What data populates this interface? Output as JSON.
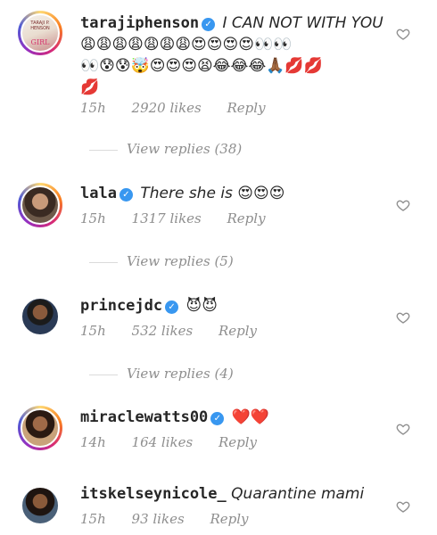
{
  "comments": [
    {
      "username": "tarajiphenson",
      "verified": true,
      "text": "I CAN NOT WITH YOU",
      "emoji_line_1": "😩😩😩😩😩😩😩😍😍😍😍👀👀",
      "emoji_line_2": "👀😰😰🤯😍😍😍😫😂😂😂🙏🏾💋💋",
      "emoji_line_3": "💋",
      "time": "15h",
      "likes": "2920 likes",
      "reply": "Reply",
      "view_replies": "View replies (38)",
      "avatar_text_top": "TARAJI P. HENSON",
      "avatar_text_bottom": "GIRL"
    },
    {
      "username": "lala",
      "verified": true,
      "text": "There she is 😍😍😍",
      "time": "15h",
      "likes": "1317 likes",
      "reply": "Reply",
      "view_replies": "View replies (5)"
    },
    {
      "username": "princejdc",
      "verified": true,
      "text": "😈😈",
      "time": "15h",
      "likes": "532 likes",
      "reply": "Reply",
      "view_replies": "View replies (4)"
    },
    {
      "username": "miraclewatts00",
      "verified": true,
      "text": "❤️❤️",
      "time": "14h",
      "likes": "164 likes",
      "reply": "Reply"
    },
    {
      "username": "itskelseynicole_",
      "verified": false,
      "text": "Quarantine mami",
      "time": "15h",
      "likes": "93 likes",
      "reply": "Reply"
    }
  ],
  "icons": {
    "like": "heart-outline-icon",
    "verified": "verified-badge-icon"
  },
  "colors": {
    "verified": "#3897f0",
    "muted": "#8e8e8e"
  }
}
